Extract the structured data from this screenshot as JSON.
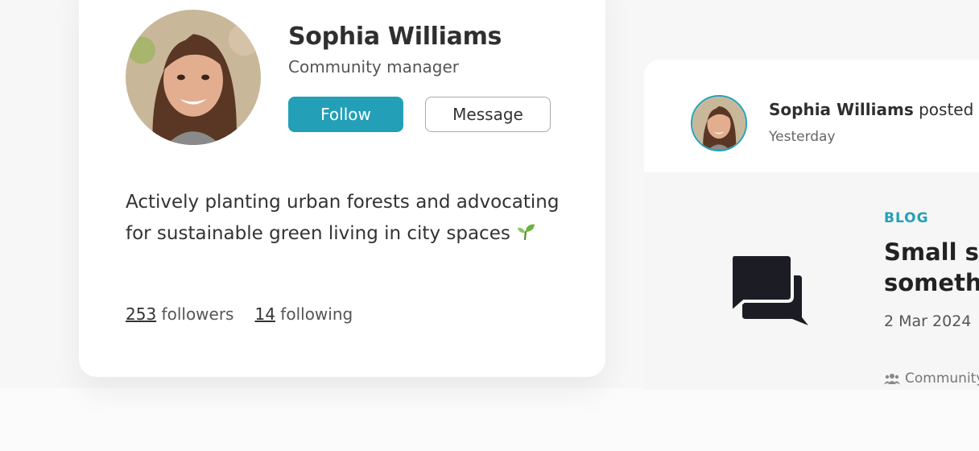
{
  "profile": {
    "name": "Sophia Williams",
    "role": "Community manager",
    "follow_label": "Follow",
    "message_label": "Message",
    "bio": "Actively planting urban forests and advocating for sustainable green living in city spaces",
    "followers_count": "253",
    "followers_label": "followers",
    "following_count": "14",
    "following_label": "following"
  },
  "post": {
    "author": "Sophia Williams",
    "action": "posted",
    "time": "Yesterday",
    "tag": "BLOG",
    "title": "Small steps, something",
    "date": "2 Mar 2024",
    "community": "Community"
  },
  "colors": {
    "accent": "#23a0b8",
    "text_dark": "#2f2f2f",
    "icon_dark": "#1c1c24"
  },
  "icons": [
    "sprout-icon",
    "chat-bubbles-icon",
    "people-icon"
  ]
}
